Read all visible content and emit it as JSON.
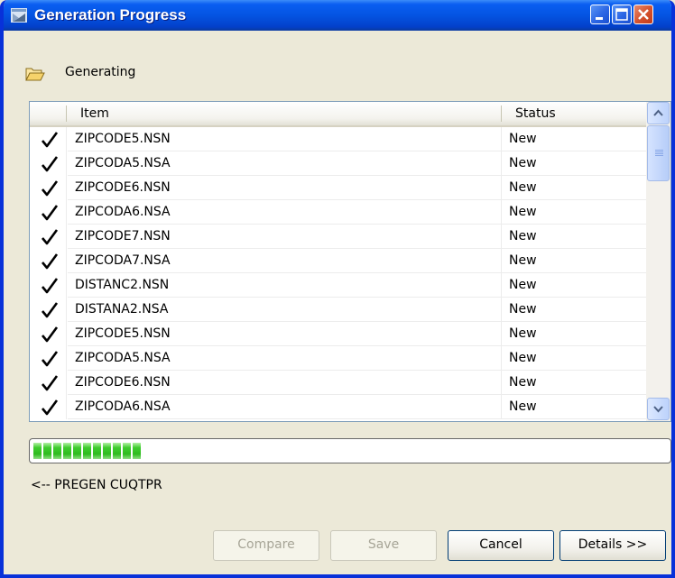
{
  "window": {
    "title": "Generation Progress"
  },
  "phase": {
    "label": "Generating",
    "icon": "folder-open-icon"
  },
  "list": {
    "columns": {
      "item": "Item",
      "status": "Status"
    },
    "rows": [
      {
        "item": "ZIPCODE5.NSN",
        "status": "New",
        "done": true
      },
      {
        "item": "ZIPCODA5.NSA",
        "status": "New",
        "done": true
      },
      {
        "item": "ZIPCODE6.NSN",
        "status": "New",
        "done": true
      },
      {
        "item": "ZIPCODA6.NSA",
        "status": "New",
        "done": true
      },
      {
        "item": "ZIPCODE7.NSN",
        "status": "New",
        "done": true
      },
      {
        "item": "ZIPCODA7.NSA",
        "status": "New",
        "done": true
      },
      {
        "item": "DISTANC2.NSN",
        "status": "New",
        "done": true
      },
      {
        "item": "DISTANA2.NSA",
        "status": "New",
        "done": true
      },
      {
        "item": "ZIPCODE5.NSN",
        "status": "New",
        "done": true
      },
      {
        "item": "ZIPCODA5.NSA",
        "status": "New",
        "done": true
      },
      {
        "item": "ZIPCODE6.NSN",
        "status": "New",
        "done": true
      },
      {
        "item": "ZIPCODA6.NSA",
        "status": "New",
        "done": true
      }
    ]
  },
  "progress": {
    "fraction": 0.18,
    "color": "#2ebb1f"
  },
  "current_step": "<-- PREGEN CUQTPR",
  "buttons": {
    "compare": "Compare",
    "save": "Save",
    "cancel": "Cancel",
    "details": "Details >>"
  }
}
